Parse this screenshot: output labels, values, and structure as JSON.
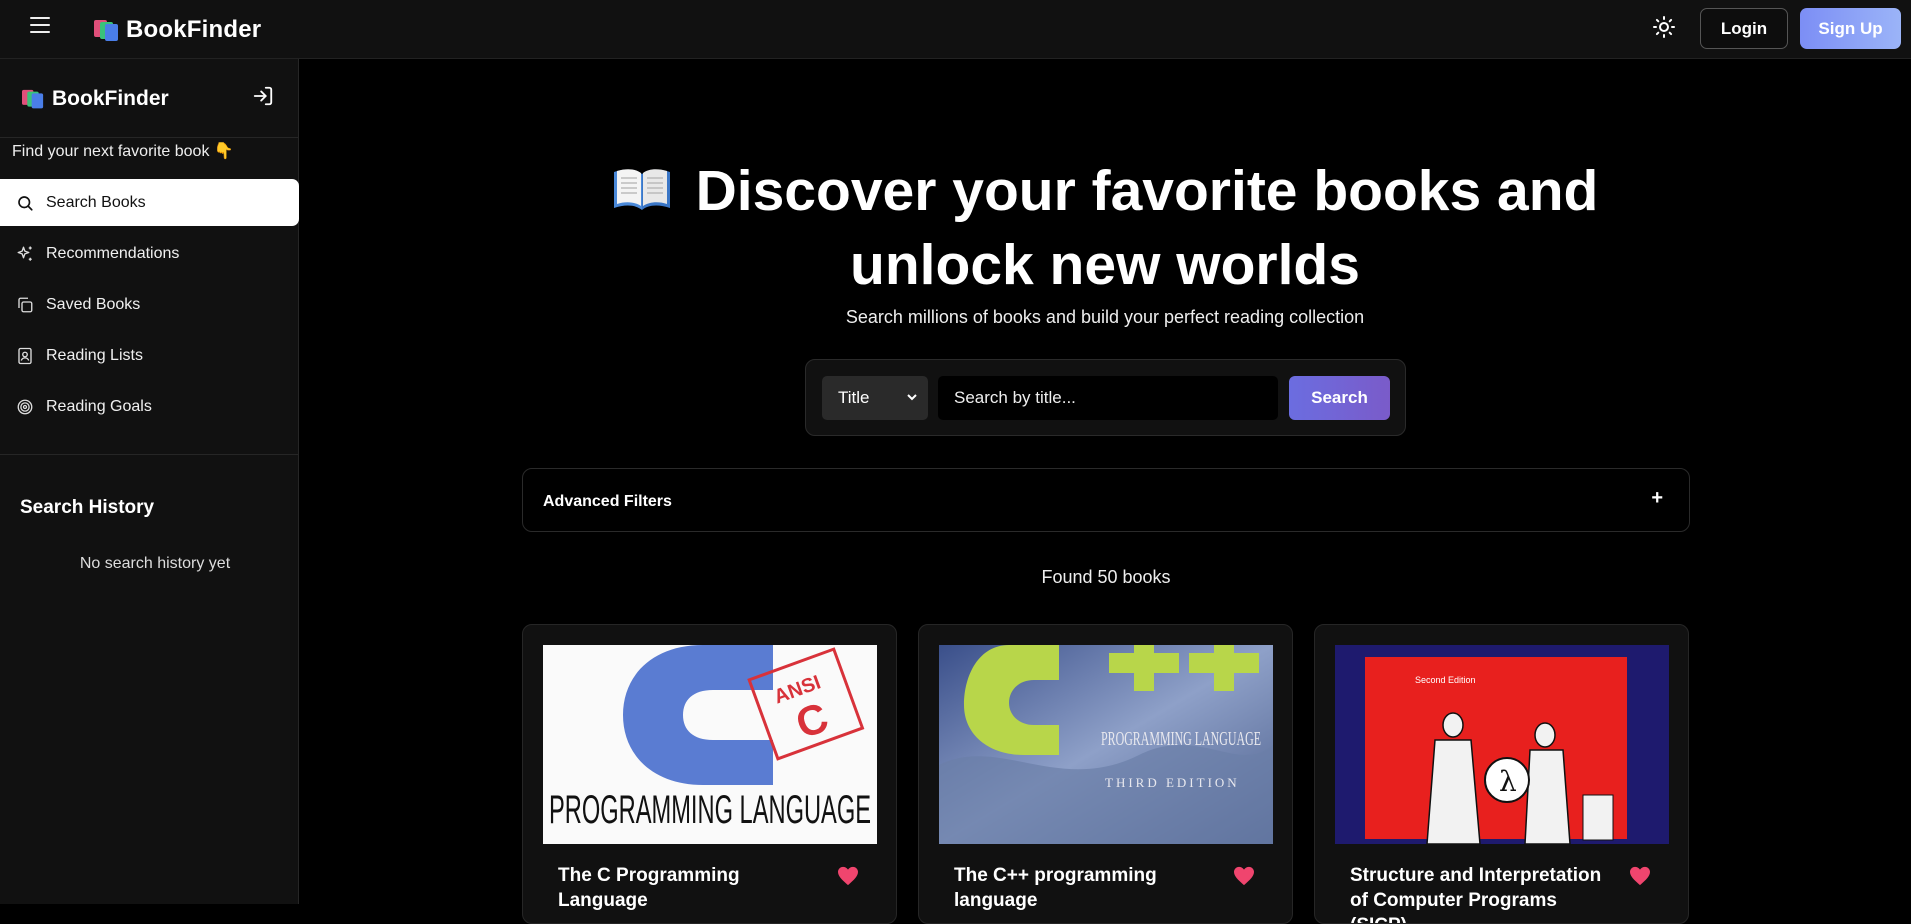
{
  "topbar": {
    "brand": "BookFinder",
    "login_label": "Login",
    "signup_label": "Sign Up"
  },
  "sidebar": {
    "brand": "BookFinder",
    "tagline": "Find your next favorite book 👇",
    "items": [
      {
        "label": "Search Books",
        "icon": "search-icon",
        "active": true
      },
      {
        "label": "Recommendations",
        "icon": "sparkles-icon",
        "active": false
      },
      {
        "label": "Saved Books",
        "icon": "copy-icon",
        "active": false
      },
      {
        "label": "Reading Lists",
        "icon": "contact-book-icon",
        "active": false
      },
      {
        "label": "Reading Goals",
        "icon": "target-icon",
        "active": false
      }
    ],
    "history_title": "Search History",
    "history_empty": "No search history yet"
  },
  "hero": {
    "title": "Discover your favorite books and unlock new worlds",
    "subtitle": "Search millions of books and build your perfect reading collection"
  },
  "search": {
    "type_selected": "Title",
    "placeholder": "Search by title...",
    "button_label": "Search"
  },
  "filters": {
    "label": "Advanced Filters",
    "toggle": "+"
  },
  "results": {
    "found_text": "Found 50 books",
    "books": [
      {
        "title": "The C Programming Language",
        "cover_text": "PROGRAMMING LANGUAGE",
        "cover_badge": "ANSI"
      },
      {
        "title": "The C++ programming language",
        "cover_text": "PROGRAMMING LANGUAGE",
        "cover_subtext": "THIRD EDITION"
      },
      {
        "title": "Structure and Interpretation of Computer Programs (SICP)",
        "cover_text": "Second Edition"
      }
    ]
  },
  "colors": {
    "accent_search": "#6b6de0",
    "signup_button": "#8aa0f6",
    "heart": "#f0456e"
  }
}
